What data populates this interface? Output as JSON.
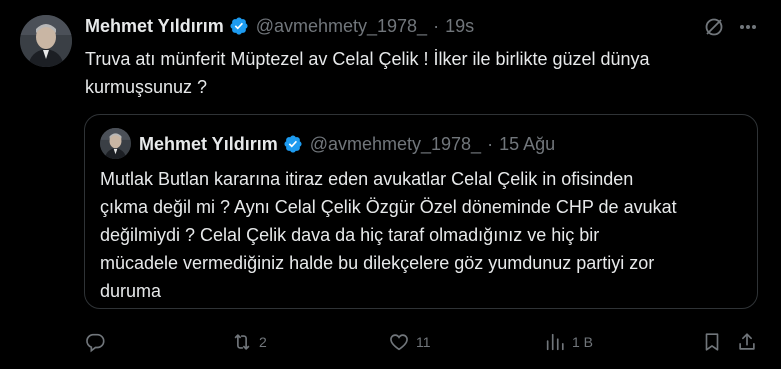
{
  "tweet": {
    "author_name": "Mehmet Yıldırım",
    "handle": "@avmehmety_1978_",
    "separator": "·",
    "time": "19s",
    "text_line1": "Truva atı münferit Müptezel av Celal Çelik ! İlker ile birlikte güzel dünya",
    "text_line2": "kurmuşsunuz ?"
  },
  "quoted": {
    "author_name": "Mehmet Yıldırım",
    "handle": "@avmehmety_1978_",
    "separator": "·",
    "time": "15 Ağu",
    "lines": [
      "Mutlak Butlan kararına itiraz eden avukatlar Celal Çelik in ofisinden",
      "çıkma değil mi ? Aynı Celal Çelik Özgür Özel döneminde CHP de avukat",
      "değilmiydi ? Celal Çelik  dava da hiç taraf olmadığınız ve hiç bir",
      "mücadele vermediğiniz halde bu dilekçelere göz yumdunuz partiyi zor",
      "duruma"
    ]
  },
  "actions": {
    "replies": "",
    "retweets": "2",
    "likes": "11",
    "views": "1 B"
  },
  "colors": {
    "background": "#000000",
    "text": "#e7e9ea",
    "muted": "#71767b",
    "verified": "#1d9bf0",
    "border": "#2f3336"
  },
  "icons": [
    "verified-badge-icon",
    "grok-icon",
    "more-icon",
    "reply-icon",
    "retweet-icon",
    "like-icon",
    "views-icon",
    "bookmark-icon",
    "share-icon"
  ]
}
